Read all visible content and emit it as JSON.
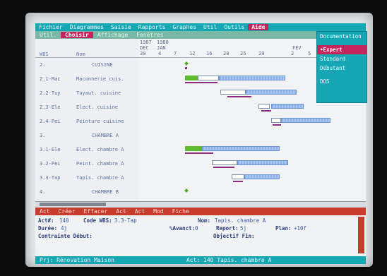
{
  "menubar": {
    "items": [
      "Fichier",
      "Diagrammes",
      "Saisie",
      "Rapports",
      "Graphes",
      "Util",
      "Outils",
      "Aide"
    ]
  },
  "toolbar": {
    "items": [
      "Util.",
      "Choisir",
      "Affichage",
      "Fenêtres"
    ]
  },
  "table": {
    "headers": {
      "wbs": "WBS",
      "nom": "Nom"
    },
    "rows": [
      {
        "wbs": "2.",
        "nom": "CUISINE",
        "group": true
      },
      {
        "wbs": "2.1-Mac",
        "nom": "Maconnerie cuis.",
        "group": false
      },
      {
        "wbs": "2.2-Tuy",
        "nom": "Tuyaut. cuisine",
        "group": false
      },
      {
        "wbs": "2.3-Ele",
        "nom": "Elect. cuisine",
        "group": false
      },
      {
        "wbs": "2.4-Pei",
        "nom": "Peinture cuisine",
        "group": false
      },
      {
        "wbs": "3.",
        "nom": "CHAMBRE A",
        "group": true
      },
      {
        "wbs": "3.1-Ele",
        "nom": "Elect. chambre A",
        "group": false
      },
      {
        "wbs": "3.2-Pei",
        "nom": "Peint. chambre A",
        "group": false
      },
      {
        "wbs": "3.3-Tap",
        "nom": "Tapis. chambre A",
        "group": false
      },
      {
        "wbs": "4.",
        "nom": "CHAMBRE B",
        "group": true
      }
    ]
  },
  "gantt": {
    "header": {
      "year1": "1987",
      "year2": "1988",
      "month1": "DEC",
      "month2": "JAN",
      "month3": "FEV",
      "days": [
        "30",
        "4",
        "7",
        "12",
        "16",
        "20",
        "25",
        "29",
        "2",
        "5"
      ]
    }
  },
  "dropdown": {
    "items": [
      "Documentation",
      "Expert",
      "Standard",
      "Débutant",
      "DOS"
    ],
    "highlighted": "Expert"
  },
  "formbar": {
    "items": [
      "Act",
      "Créer",
      "Effacer",
      "Act",
      "Act",
      "Mod",
      "Fiche"
    ]
  },
  "form": {
    "act_label": "Act#:",
    "act_value": "140",
    "code_label": "Code WBS:",
    "code_value": "3.3-Tap",
    "nom_label": "Nom:",
    "nom_value": "Tapis. chambre A",
    "duree_label": "Durée:",
    "duree_value": "4j",
    "avancement_label": "%Avanct:",
    "avancement_value": "0",
    "report_label": "Report:",
    "report_value": "5j",
    "plan_label": "Plan:",
    "plan_value": "+10f",
    "contrainte_label": "Contrainte Début:",
    "objectif_label": "Objectif Fin:"
  },
  "statusbar": {
    "project": "Prj: Rénovation Maison",
    "activity": "Act: 140 Tapis. chambre A"
  }
}
